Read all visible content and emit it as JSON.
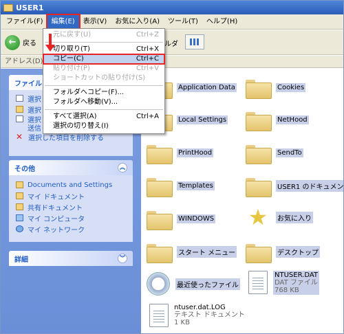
{
  "window": {
    "title": "USER1"
  },
  "menubar": {
    "items": [
      "ファイル(F)",
      "編集(E)",
      "表示(V)",
      "お気に入り(A)",
      "ツール(T)",
      "ヘルプ(H)"
    ]
  },
  "toolbar": {
    "back_label": "戻る",
    "folders_label": "ルダ"
  },
  "addressbar": {
    "label": "アドレス(D)"
  },
  "edit_menu": {
    "items": [
      {
        "label": "元に戻す(U)",
        "shortcut": "Ctrl+Z",
        "disabled": true
      },
      {
        "label": "切り取り(T)",
        "shortcut": "Ctrl+X"
      },
      {
        "label": "コピー(C)",
        "shortcut": "Ctrl+C",
        "highlighted": true
      },
      {
        "label": "貼り付け(P)",
        "shortcut": "Ctrl+V",
        "disabled": true
      },
      {
        "label": "ショートカットの貼り付け(S)",
        "shortcut": "",
        "disabled": true
      },
      {
        "label": "フォルダへコピー(F)...",
        "shortcut": ""
      },
      {
        "label": "フォルダへ移動(V)...",
        "shortcut": ""
      },
      {
        "label": "すべて選択(A)",
        "shortcut": "Ctrl+A"
      },
      {
        "label": "選択の切り替え(I)",
        "shortcut": ""
      }
    ]
  },
  "leftpane": {
    "file_tasks": {
      "title": "ファイル",
      "items": [
        "選択",
        "選択",
        "選択",
        "送信",
        "選択した項目を削除する"
      ]
    },
    "other_places": {
      "title": "その他",
      "items": [
        "Documents and Settings",
        "マイ ドキュメント",
        "共有ドキュメント",
        "マイ コンピュータ",
        "マイ ネットワーク"
      ]
    },
    "details": {
      "title": "詳細"
    }
  },
  "files": [
    {
      "name": "Application Data",
      "icon": "folder"
    },
    {
      "name": "Cookies",
      "icon": "folder"
    },
    {
      "name": "Local Settings",
      "icon": "folder"
    },
    {
      "name": "NetHood",
      "icon": "folder"
    },
    {
      "name": "PrintHood",
      "icon": "folder"
    },
    {
      "name": "SendTo",
      "icon": "folder"
    },
    {
      "name": "Templates",
      "icon": "folder"
    },
    {
      "name": "USER1 のドキュメント",
      "icon": "folder"
    },
    {
      "name": "WINDOWS",
      "icon": "folder"
    },
    {
      "name": "お気に入り",
      "icon": "star"
    },
    {
      "name": "スタート メニュー",
      "icon": "folder"
    },
    {
      "name": "デスクトップ",
      "icon": "folder"
    },
    {
      "name": "最近使ったファイル",
      "icon": "recent"
    },
    {
      "name": "NTUSER.DAT",
      "type": "DAT ファイル",
      "size": "768 KB",
      "icon": "doc"
    },
    {
      "name": "ntuser.dat.LOG",
      "type": "テキスト ドキュメント",
      "size": "1 KB",
      "icon": "doc"
    }
  ]
}
